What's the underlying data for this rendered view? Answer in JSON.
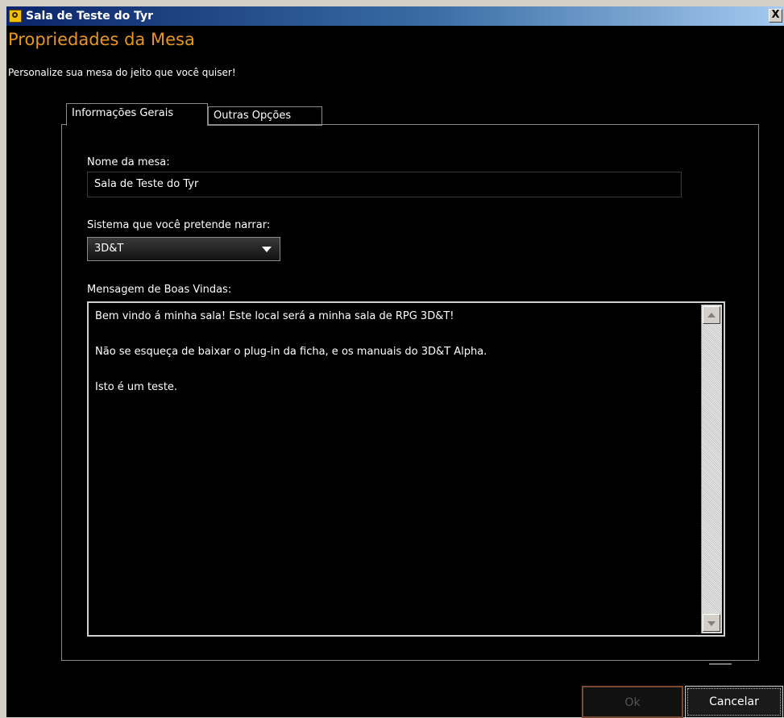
{
  "window": {
    "title": "Sala de Teste do Tyr",
    "close_label": "X"
  },
  "header": {
    "title": "Propriedades da Mesa",
    "subtitle": "Personalize sua mesa do jeito que você quiser!"
  },
  "tabs": [
    {
      "label": "Informações Gerais",
      "active": true
    },
    {
      "label": "Outras Opções",
      "active": false
    }
  ],
  "form": {
    "table_name_label": "Nome da mesa:",
    "table_name_value": "Sala de Teste do Tyr",
    "system_label": "Sistema que você pretende narrar:",
    "system_value": "3D&T",
    "welcome_label": "Mensagem de Boas Vindas:",
    "welcome_lines": [
      "Bem vindo á minha sala! Este local será a minha sala de RPG 3D&T!",
      "Não se esqueça de baixar o plug-in da ficha, e os manuais do 3D&T Alpha.",
      "Isto é um teste."
    ]
  },
  "buttons": {
    "ok_label": "Ok",
    "cancel_label": "Cancelar"
  },
  "colors": {
    "heading_accent": "#e8961e",
    "ok_border": "#7a4a32"
  }
}
